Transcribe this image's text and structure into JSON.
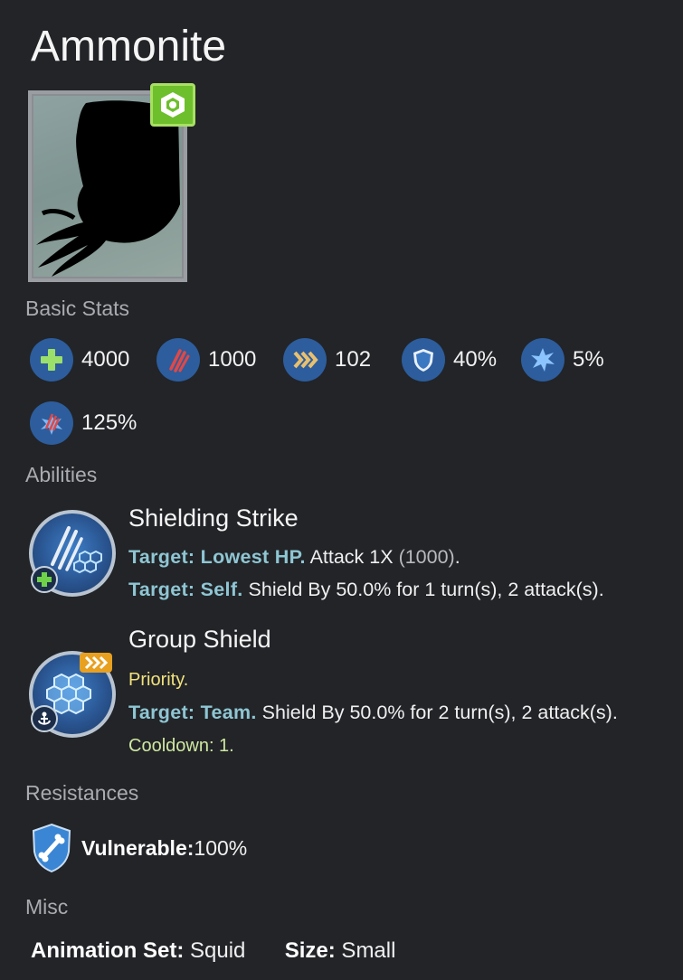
{
  "creature": {
    "name": "Ammonite"
  },
  "basic_stats": {
    "label": "Basic Stats",
    "items": [
      {
        "icon": "health-icon",
        "value": "4000"
      },
      {
        "icon": "damage-icon",
        "value": "1000"
      },
      {
        "icon": "speed-icon",
        "value": "102"
      },
      {
        "icon": "armor-icon",
        "value": "40%"
      },
      {
        "icon": "crit-chance-icon",
        "value": "5%"
      },
      {
        "icon": "crit-damage-icon",
        "value": "125%"
      }
    ]
  },
  "abilities": {
    "label": "Abilities",
    "items": [
      {
        "name": "Shielding Strike",
        "icon": "claw-shield-icon",
        "lines": [
          {
            "target": "Target: Lowest HP.",
            "text": "Attack 1X",
            "extra": "(1000)",
            "tail": "."
          },
          {
            "target": "Target: Self.",
            "text": "Shield By 50.0% for 1 turn(s), 2 attack(s)."
          }
        ]
      },
      {
        "name": "Group Shield",
        "icon": "hex-shield-icon",
        "priority": "Priority.",
        "lines": [
          {
            "target": "Target: Team.",
            "text": "Shield By 50.0% for 2 turn(s), 2 attack(s)."
          }
        ],
        "cooldown": "Cooldown: 1."
      }
    ]
  },
  "resistances": {
    "label": "Resistances",
    "items": [
      {
        "icon": "vulnerable-icon",
        "name": "Vulnerable",
        "sep": ":",
        "value": " 100%"
      }
    ]
  },
  "misc": {
    "label": "Misc",
    "animation_label": "Animation Set:",
    "animation_value": " Squid",
    "size_label": "Size:",
    "size_value": " Small"
  },
  "colors": {
    "background": "#222428",
    "target_text": "#8fc6d3",
    "priority_text": "#f2e27c",
    "cooldown_text": "#cfe8a0",
    "rarity_badge": "#6ebf2c"
  }
}
